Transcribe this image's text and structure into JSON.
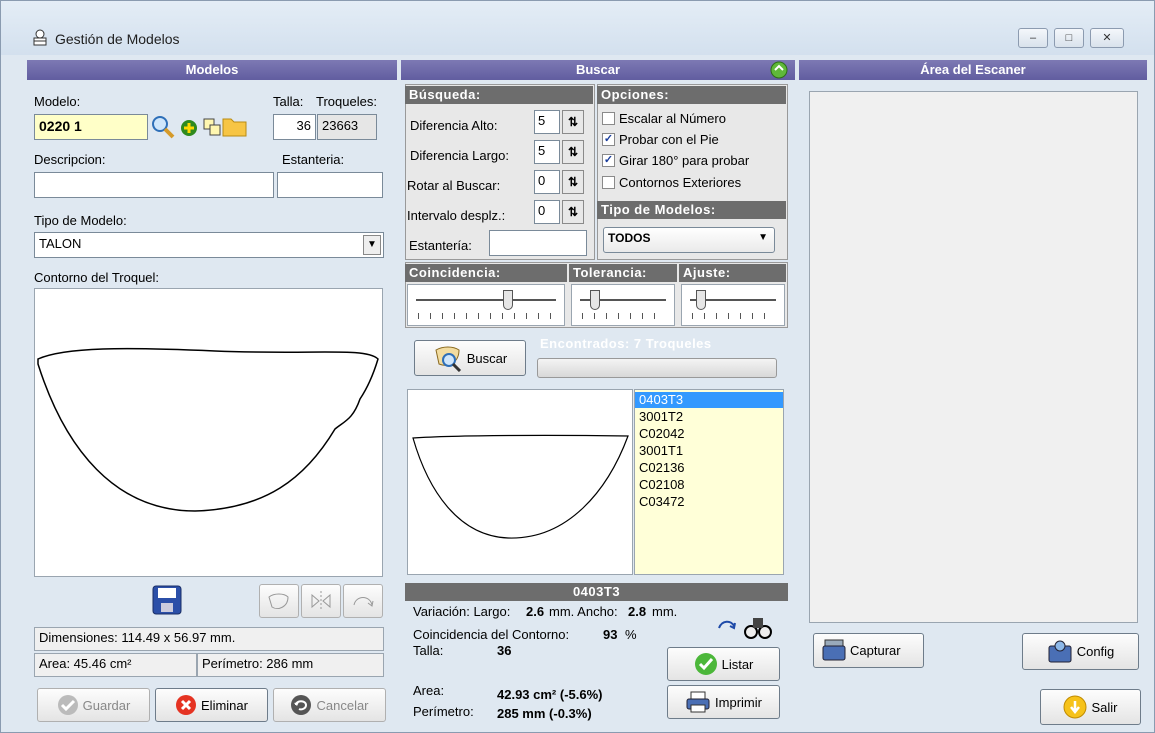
{
  "window": {
    "title": "Gestión de Modelos",
    "min": "–",
    "max": "□",
    "close": "✕"
  },
  "modelos": {
    "header": "Modelos",
    "modelo_label": "Modelo:",
    "talla_label": "Talla:",
    "troqueles_label": "Troqueles:",
    "modelo_value": "0220 1",
    "talla_value": "36",
    "troqueles_value": "23663",
    "descripcion_label": "Descripcion:",
    "estanteria_label": "Estanteria:",
    "descripcion_value": "",
    "estanteria_value": "",
    "tipo_label": "Tipo de Modelo:",
    "tipo_value": "TALON",
    "contorno_label": "Contorno del Troquel:",
    "dimensiones": "Dimensiones: 114.49 x 56.97 mm.",
    "area": "Area: 45.46 cm²",
    "perimetro": "Perímetro: 286 mm",
    "guardar": "Guardar",
    "eliminar": "Eliminar",
    "cancelar": "Cancelar"
  },
  "buscar": {
    "header": "Buscar",
    "busqueda_head": "Búsqueda:",
    "opciones_head": "Opciones:",
    "dif_alto_label": "Diferencia Alto:",
    "dif_alto_value": "5",
    "dif_largo_label": "Diferencia Largo:",
    "dif_largo_value": "5",
    "rotar_label": "Rotar al Buscar:",
    "rotar_value": "0",
    "intervalo_label": "Intervalo desplz.:",
    "intervalo_value": "0",
    "estanteria_label": "Estantería:",
    "estanteria_value": "",
    "opt1": "Escalar al Número",
    "opt2": "Probar con el Pie",
    "opt3": "Girar 180° para probar",
    "opt4": "Contornos Exteriores",
    "opt1_checked": false,
    "opt2_checked": true,
    "opt3_checked": true,
    "opt4_checked": false,
    "tipo_head": "Tipo de Modelos:",
    "tipo_value": "TODOS",
    "coincidencia_head": "Coincidencia:",
    "tolerancia_head": "Tolerancia:",
    "ajuste_head": "Ajuste:",
    "buscar_btn": "Buscar",
    "encontrados": "Encontrados:   7   Troqueles",
    "results": [
      "0403T3",
      "3001T2",
      "C02042",
      "3001T1",
      "C02136",
      "C02108",
      "C03472"
    ],
    "selected_index": 0,
    "detail_title": "0403T3",
    "variacion_label": "Variación: Largo:",
    "variacion_largo": "2.6",
    "mm_ancho": "mm. Ancho:",
    "variacion_ancho": "2.8",
    "mm": "mm.",
    "coincidencia_label": "Coincidencia del Contorno:",
    "coincidencia_value": "93",
    "pct": "%",
    "talla_label": "Talla:",
    "talla_value": "36",
    "listar_btn": "Listar",
    "area_label": "Area:",
    "area_value": "42.93 cm² (-5.6%)",
    "perimetro_label": "Perímetro:",
    "perimetro_value": "285 mm (-0.3%)",
    "imprimir_btn": "Imprimir"
  },
  "escaner": {
    "header": "Área del Escaner",
    "capturar_btn": "Capturar",
    "config_btn": "Config",
    "salir_btn": "Salir"
  }
}
